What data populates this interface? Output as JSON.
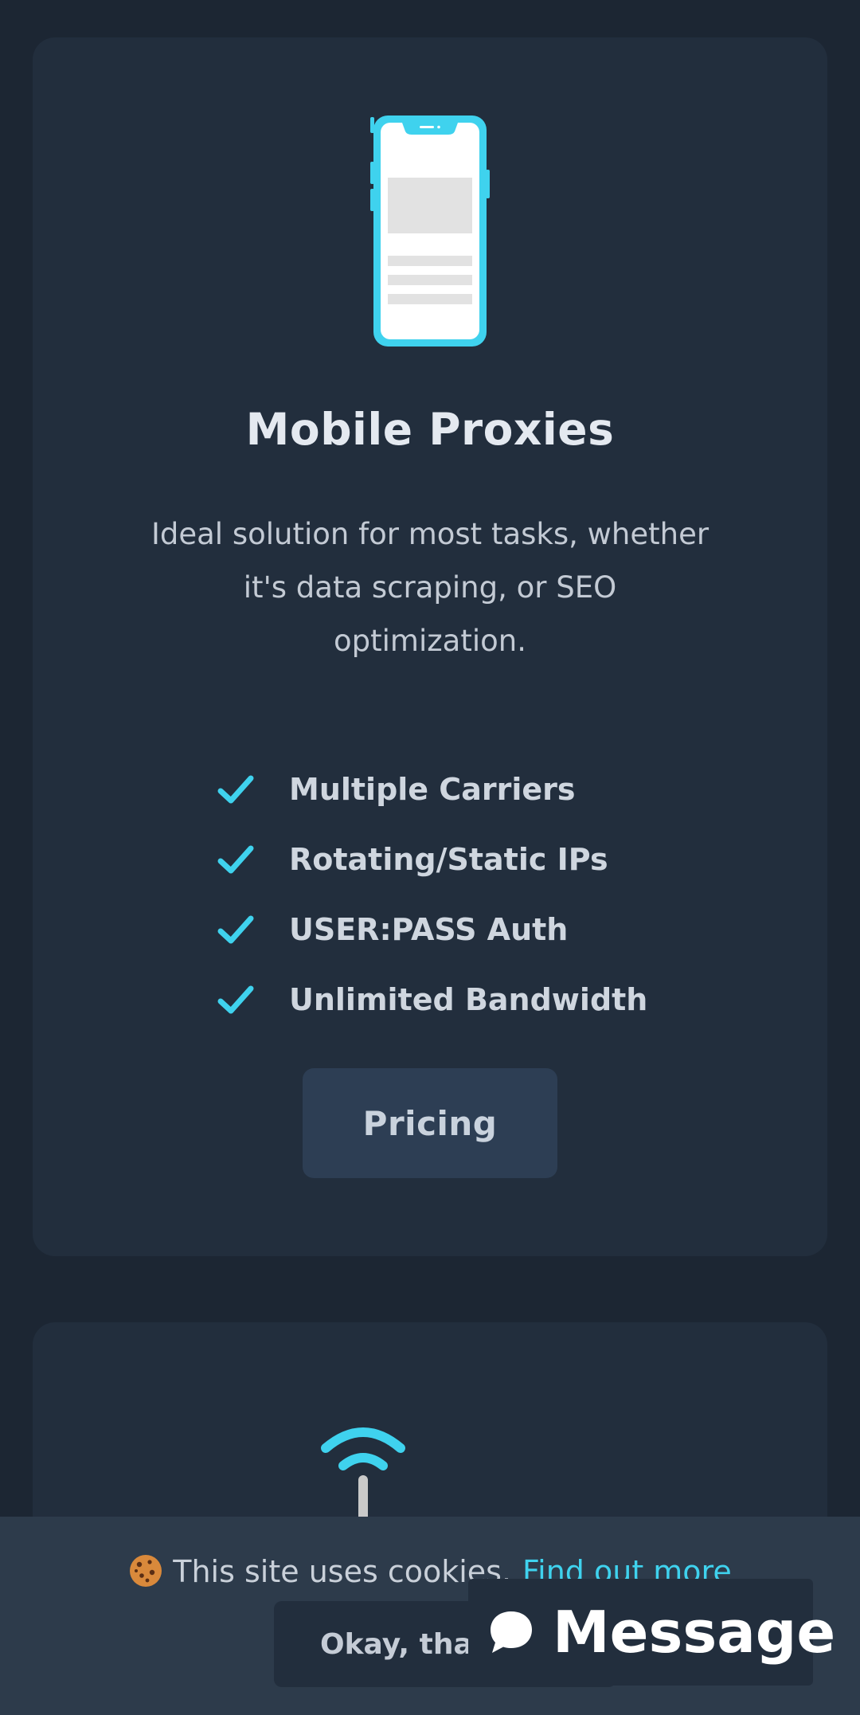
{
  "card1": {
    "title": "Mobile Proxies",
    "description": "Ideal solution for most tasks, whether it's data scraping, or SEO optimization.",
    "features": [
      "Multiple Carriers",
      "Rotating/Static IPs",
      "USER:PASS Auth",
      "Unlimited Bandwidth"
    ],
    "pricing_label": "Pricing",
    "icon": "smartphone-icon"
  },
  "card2": {
    "icon": "wifi-icon"
  },
  "cookie_bar": {
    "text": "This site uses cookies.",
    "link": "Find out more",
    "accept_label": "Okay, thanks",
    "icon": "cookie-icon"
  },
  "message_widget": {
    "label": "Message",
    "icon": "chat-bubble-icon"
  },
  "colors": {
    "background": "#1c2633",
    "card": "#222e3d",
    "accent": "#3fd2ee",
    "button": "#2d3e54"
  }
}
